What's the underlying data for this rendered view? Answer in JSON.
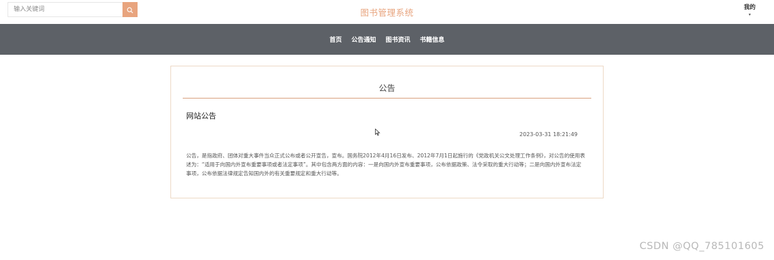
{
  "header": {
    "search": {
      "placeholder": "输入关键词",
      "value": ""
    },
    "search_icon": "search-icon",
    "site_title": "图书管理系统",
    "mine_label": "我的",
    "mine_caret": "▾"
  },
  "nav": {
    "items": [
      {
        "label": "首页"
      },
      {
        "label": "公告通知"
      },
      {
        "label": "图书资讯"
      },
      {
        "label": "书籍信息"
      }
    ]
  },
  "notice": {
    "section_title": "公告",
    "title": "网站公告",
    "time": "2023-03-31 18:21:49",
    "body": "公告，是指政府、团体对重大事件当众正式公布或者公开宣告，宣布。国务院2012年4月16日发布、2012年7月1日起施行的《党政机关公文处理工作条例》，对公告的使用表述为：“适用于向国内外宣布重要事项或者法定事项”。其中包含两方面的内容：一是向国内外宣布重要事项，公布依据政策、法令采取的重大行动等；二是向国内外宣布法定事项，公布依据法律规定告知国内外的有关重要规定和重大行动等。"
  },
  "watermark": "CSDN @QQ_785101605",
  "colors": {
    "accent": "#e8a47e",
    "navbar": "#5d6167",
    "card_border": "#edd9c6"
  }
}
